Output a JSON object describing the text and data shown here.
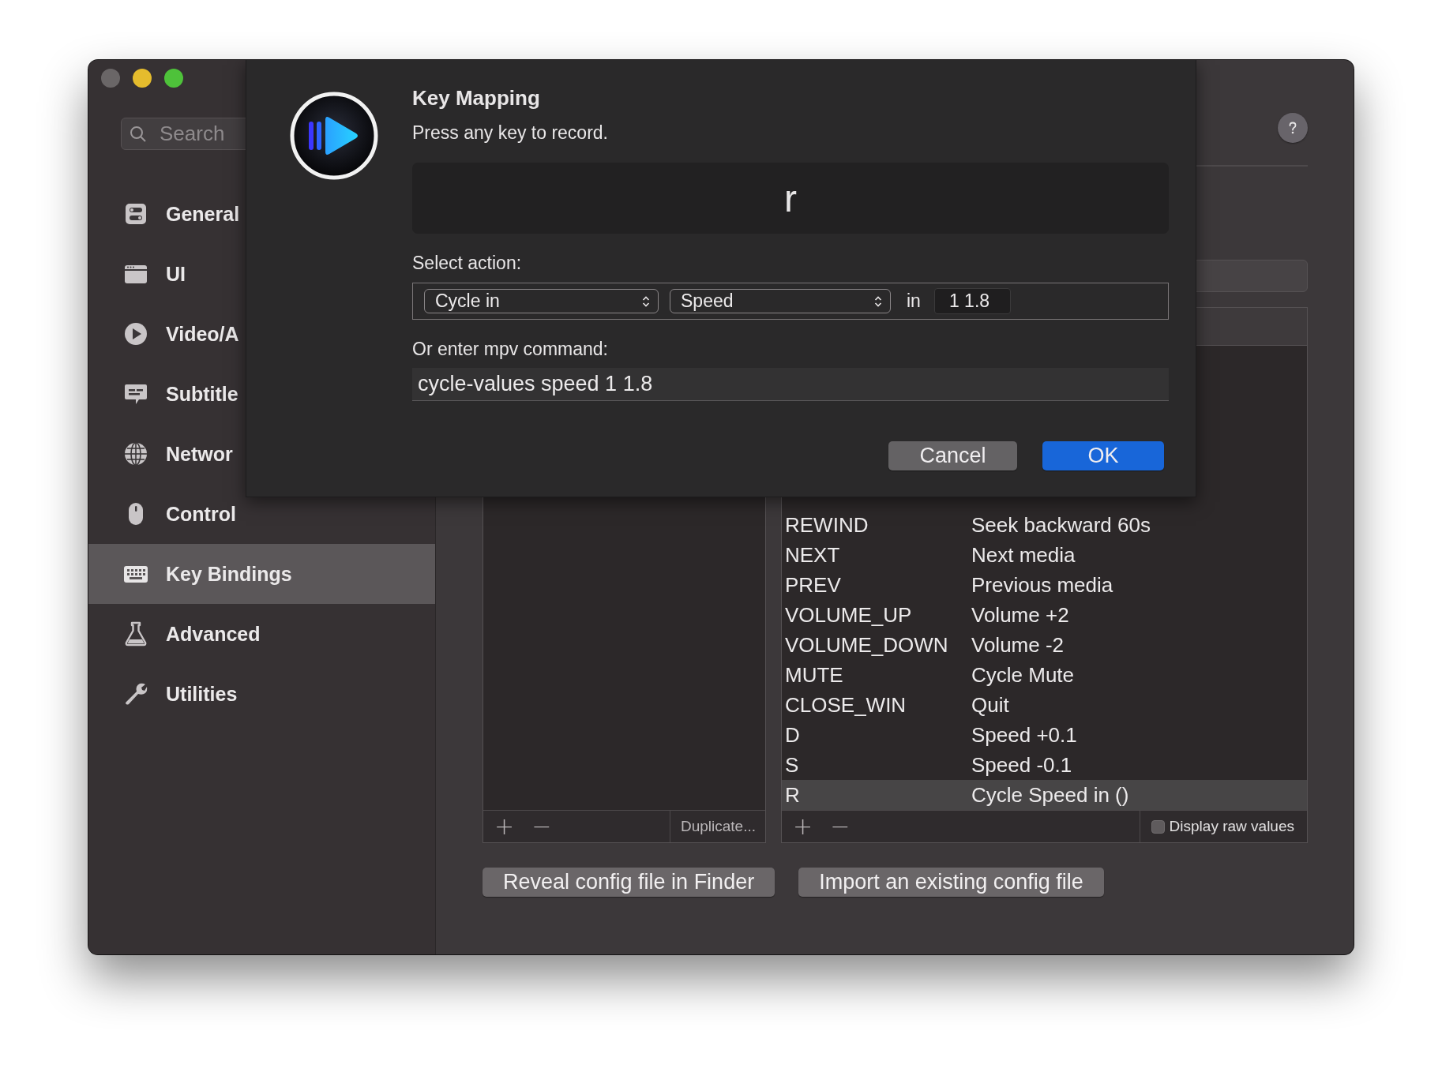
{
  "window": {
    "traffic_lights": [
      {
        "color": "#6a6667"
      },
      {
        "color": "#e5bc2d"
      },
      {
        "color": "#4ec23a"
      }
    ]
  },
  "sidebar": {
    "search": {
      "placeholder": "Search"
    },
    "items": [
      {
        "label": "General",
        "selected": false
      },
      {
        "label": "UI",
        "selected": false
      },
      {
        "label": "Video/A",
        "selected": false
      },
      {
        "label": "Subtitle",
        "selected": false
      },
      {
        "label": "Networ",
        "selected": false
      },
      {
        "label": "Control",
        "selected": false
      },
      {
        "label": "Key Bindings",
        "selected": true
      },
      {
        "label": "Advanced",
        "selected": false
      },
      {
        "label": "Utilities",
        "selected": false
      }
    ]
  },
  "profiles_footer": {
    "add": "+",
    "remove": "−",
    "duplicate": "Duplicate..."
  },
  "bindings_table": {
    "rows": [
      {
        "key": "REWIND",
        "action": "Seek backward 60s",
        "selected": false
      },
      {
        "key": "NEXT",
        "action": "Next media",
        "selected": false
      },
      {
        "key": "PREV",
        "action": "Previous media",
        "selected": false
      },
      {
        "key": "VOLUME_UP",
        "action": "Volume +2",
        "selected": false
      },
      {
        "key": "VOLUME_DOWN",
        "action": "Volume -2",
        "selected": false
      },
      {
        "key": "MUTE",
        "action": "Cycle Mute",
        "selected": false
      },
      {
        "key": "CLOSE_WIN",
        "action": "Quit",
        "selected": false
      },
      {
        "key": "D",
        "action": "Speed +0.1",
        "selected": false
      },
      {
        "key": "S",
        "action": "Speed -0.1",
        "selected": false
      },
      {
        "key": "R",
        "action": "Cycle Speed in ()",
        "selected": true
      }
    ]
  },
  "bindings_footer": {
    "add": "+",
    "remove": "−",
    "raw_values": {
      "label": "Display raw values",
      "checked": false
    }
  },
  "buttons": [
    "Reveal config file in Finder",
    "Import an existing config file"
  ],
  "dialog": {
    "title": "Key Mapping",
    "message": "Press any key to record.",
    "key": "r",
    "action_label": "Select action:",
    "action": "Cycle in",
    "property": "Speed",
    "in_label": "in",
    "values": "1 1.8",
    "command_label": "Or enter mpv command:",
    "command": "cycle-values speed 1 1.8",
    "buttons": [
      {
        "label": "Cancel",
        "kind": "default"
      },
      {
        "label": "OK",
        "kind": "primary"
      }
    ]
  }
}
